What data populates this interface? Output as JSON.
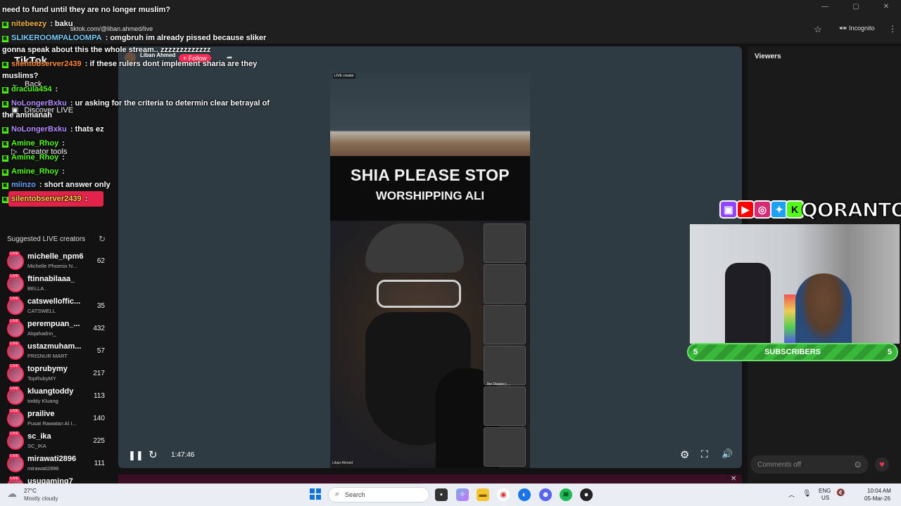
{
  "browser": {
    "url": "tiktok.com/@liban.ahmed/live",
    "incognito_label": "Incognito"
  },
  "sidebar": {
    "logo": "TikTok",
    "nav": [
      {
        "label": "Back",
        "icon": "back-arrow-icon"
      },
      {
        "label": "Discover LIVE",
        "icon": "live-icon"
      },
      {
        "label": "Creator tools",
        "icon": "play-icon"
      }
    ],
    "suggested_title": "Suggested LIVE creators",
    "creators": [
      {
        "name": "michelle_npm6",
        "sub": "Michelle Phoenix N...",
        "count": "62"
      },
      {
        "name": "ftinnabilaaa_",
        "sub": "BELLA ."
      },
      {
        "name": "catswelloffic...",
        "sub": "CATSWELL",
        "count": "35"
      },
      {
        "name": "perempuan_...",
        "sub": "Atqahadnn_",
        "count": "432"
      },
      {
        "name": "ustazmuham...",
        "sub": "PRISNUR MART",
        "count": "57"
      },
      {
        "name": "toprubymy",
        "sub": "TopRubyMY",
        "count": "217"
      },
      {
        "name": "kluangtoddy",
        "sub": "toddy Kluang",
        "count": "113"
      },
      {
        "name": "prailive",
        "sub": "Pusat Rawatan Al I...",
        "count": "140"
      },
      {
        "name": "sc_ika",
        "sub": "SC_IKA",
        "count": "225"
      },
      {
        "name": "mirawati2896",
        "sub": "mirawati2896",
        "count": "111"
      },
      {
        "name": "usugaming7",
        "sub": "",
        "count": ""
      }
    ]
  },
  "stream": {
    "streamer_name": "Liban Ahmed",
    "follow_label": "+ Follow",
    "banner_line1": "SHIA PLEASE STOP",
    "banner_line2": "WORSHIPPING ALI",
    "live_tag": "LIVE creator",
    "caption": "Liban Ahmed",
    "cam_caption": "Ibn Owaiss | ...",
    "elapsed": "1:47:46"
  },
  "viewers": {
    "title": "Viewers",
    "comments_placeholder": "Comments off"
  },
  "overlay": {
    "brand": "QORANTOS",
    "subs_left": "5",
    "subs_label": "SUBSCRIBERS",
    "subs_right": "5"
  },
  "chat": [
    {
      "user": "",
      "text": "need to fund until they are no longer muslim?",
      "color": "#ffffff"
    },
    {
      "user": "nitebeezy",
      "text": " : baku",
      "color": "#f5b642"
    },
    {
      "user": "SLIKEROOMPALOOMPA",
      "text": " : omgbruh im already pissed because sliker gonna speak about this the whole stream.. zzzzzzzzzzzzz",
      "color": "#7ad0ff"
    },
    {
      "user": "silentobserver2439",
      "text": " : if these rulers dont implement sharia are they muslims?",
      "color": "#ff8a3a"
    },
    {
      "user": "dracula454",
      "text": " :",
      "color": "#53fc18"
    },
    {
      "user": "NoLongerBxku",
      "text": " : ur asking for the criteria to determin clear betrayal of the ammanah",
      "color": "#b58cff"
    },
    {
      "user": "NoLongerBxku",
      "text": " : thats ez",
      "color": "#b58cff"
    },
    {
      "user": "Amine_Rhoy",
      "text": " :",
      "color": "#53fc18"
    },
    {
      "user": "Amine_Rhoy",
      "text": " :",
      "color": "#53fc18"
    },
    {
      "user": "Amine_Rhoy",
      "text": " :",
      "color": "#53fc18"
    },
    {
      "user": "miinzo",
      "text": " : short answer only",
      "color": "#6aa8ff"
    },
    {
      "user": "silentobserver2439",
      "text": " :",
      "color": "#ffd24a"
    }
  ],
  "taskbar": {
    "temp": "27°C",
    "weather": "Mostly cloudy",
    "search_placeholder": "Search",
    "lang1": "ENG",
    "lang2": "US",
    "time": "10:04 AM",
    "date": "05-Mar-26"
  }
}
